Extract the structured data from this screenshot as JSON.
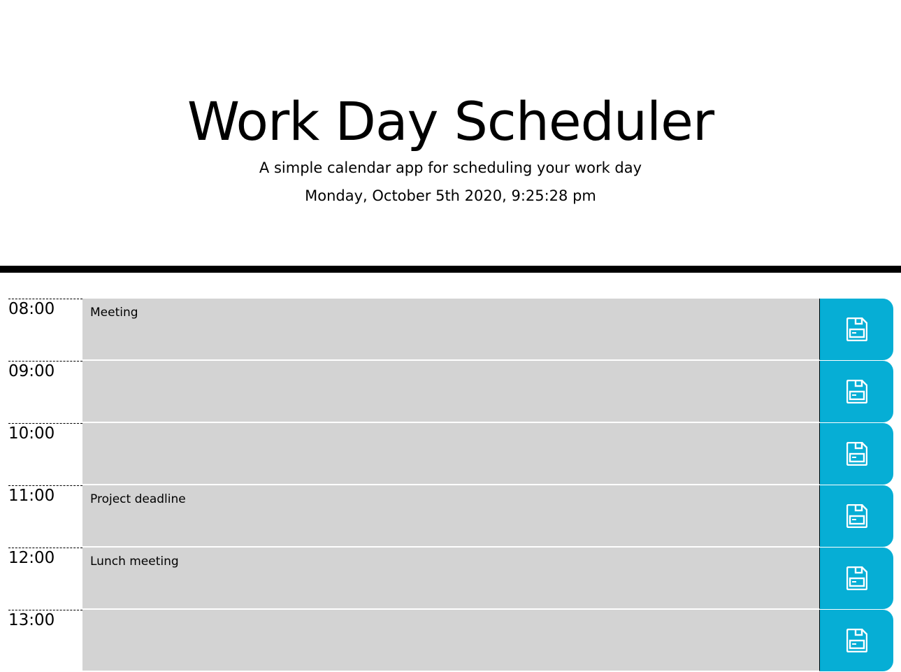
{
  "header": {
    "title": "Work Day Scheduler",
    "subtitle": "A simple calendar app for scheduling your work day",
    "current_datetime": "Monday, October 5th 2020, 9:25:28 pm"
  },
  "colors": {
    "save_button": "#06aed5",
    "past_block": "#d3d3d3",
    "divider": "#000000"
  },
  "time_blocks": [
    {
      "hour": "08:00",
      "text": "Meeting",
      "save_icon": "save-icon"
    },
    {
      "hour": "09:00",
      "text": "",
      "save_icon": "save-icon"
    },
    {
      "hour": "10:00",
      "text": "",
      "save_icon": "save-icon"
    },
    {
      "hour": "11:00",
      "text": "Project deadline",
      "save_icon": "save-icon"
    },
    {
      "hour": "12:00",
      "text": "Lunch meeting",
      "save_icon": "save-icon"
    },
    {
      "hour": "13:00",
      "text": "",
      "save_icon": "save-icon"
    }
  ]
}
